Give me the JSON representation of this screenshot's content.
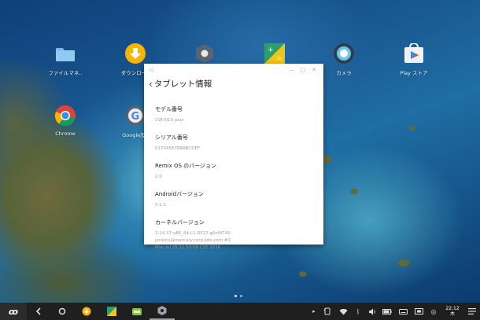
{
  "desktop": {
    "icons": [
      {
        "label": "ファイルマネ..",
        "icon": "folder-icon"
      },
      {
        "label": "ダウンロー..",
        "icon": "download-icon"
      },
      {
        "label": "",
        "icon": "settings-icon"
      },
      {
        "label": "",
        "icon": "calculator-icon"
      },
      {
        "label": "カメラ",
        "icon": "camera-icon"
      },
      {
        "label": "Play ストア",
        "icon": "play-store-icon"
      },
      {
        "label": "Chrome",
        "icon": "chrome-icon"
      },
      {
        "label": "Google設..",
        "icon": "google-settings-icon"
      }
    ]
  },
  "window": {
    "title": "タブレット情報",
    "items": [
      {
        "key": "モデル番号",
        "value": "CW-VI10 plus"
      },
      {
        "key": "シリアル番号",
        "value": "0123456789ABCDEF"
      },
      {
        "key": "Remix OS のバージョン",
        "value": "2.0"
      },
      {
        "key": "Androidバージョン",
        "value": "5.1.1"
      },
      {
        "key": "カーネルバージョン",
        "value": "3.14.37-x86_64-L1-R517-g0cf4740",
        "value2": "jenkins@mercury.corp.jide.com #1",
        "value3": "Mon Jul 25 11:53:08 CST 2016"
      }
    ]
  },
  "taskbar": {
    "time": "22:12",
    "day": "木"
  }
}
